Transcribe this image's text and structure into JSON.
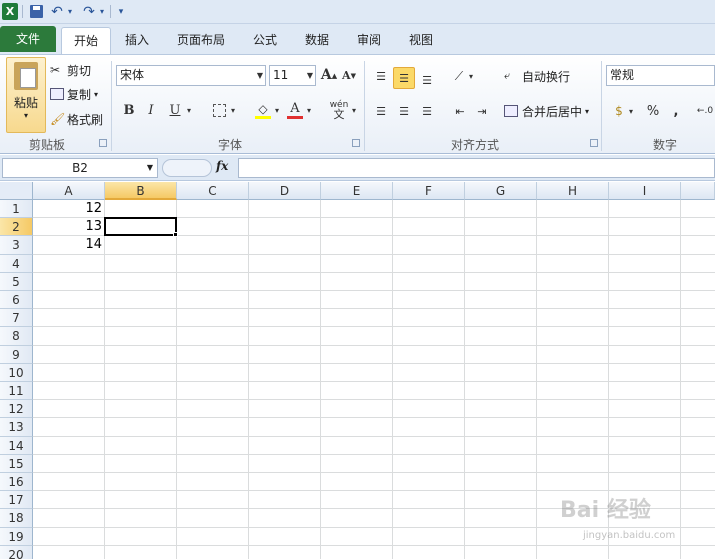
{
  "qat": {
    "logo": "X",
    "undo": "↶",
    "redo": "↷",
    "more": "▾"
  },
  "tabs": [
    "文件",
    "开始",
    "插入",
    "页面布局",
    "公式",
    "数据",
    "审阅",
    "视图"
  ],
  "clipboard": {
    "paste": "粘贴",
    "cut": "剪切",
    "copy": "复制",
    "format_painter": "格式刷",
    "label": "剪贴板"
  },
  "font": {
    "name": "宋体",
    "size": "11",
    "bold": "B",
    "italic": "I",
    "underline": "U",
    "label": "字体",
    "grow": "A",
    "shrink": "A",
    "phonetic": "wén"
  },
  "alignment": {
    "wrap_text": "自动换行",
    "merge_center": "合并后居中",
    "label": "对齐方式"
  },
  "number": {
    "format": "常规",
    "percent": "%",
    "comma": ",",
    "label": "数字"
  },
  "formula_bar": {
    "name_box": "B2",
    "fx": "fx",
    "value": ""
  },
  "columns": [
    "A",
    "B",
    "C",
    "D",
    "E",
    "F",
    "G",
    "H",
    "I"
  ],
  "rows": [
    "1",
    "2",
    "3",
    "4",
    "5",
    "6",
    "7",
    "8",
    "9",
    "10",
    "11",
    "12",
    "13",
    "14",
    "15",
    "16",
    "17",
    "18",
    "19",
    "20"
  ],
  "cells": {
    "A1": "12",
    "A2": "13",
    "A3": "14"
  },
  "selected_cell": "B2",
  "watermark": {
    "brand": "Bai 经验",
    "url": "jingyan.baidu.com"
  },
  "colors": {
    "file_tab": "#2c7a3b",
    "selection": "#f5c965",
    "ribbon_bg": "#dfe9f5"
  }
}
